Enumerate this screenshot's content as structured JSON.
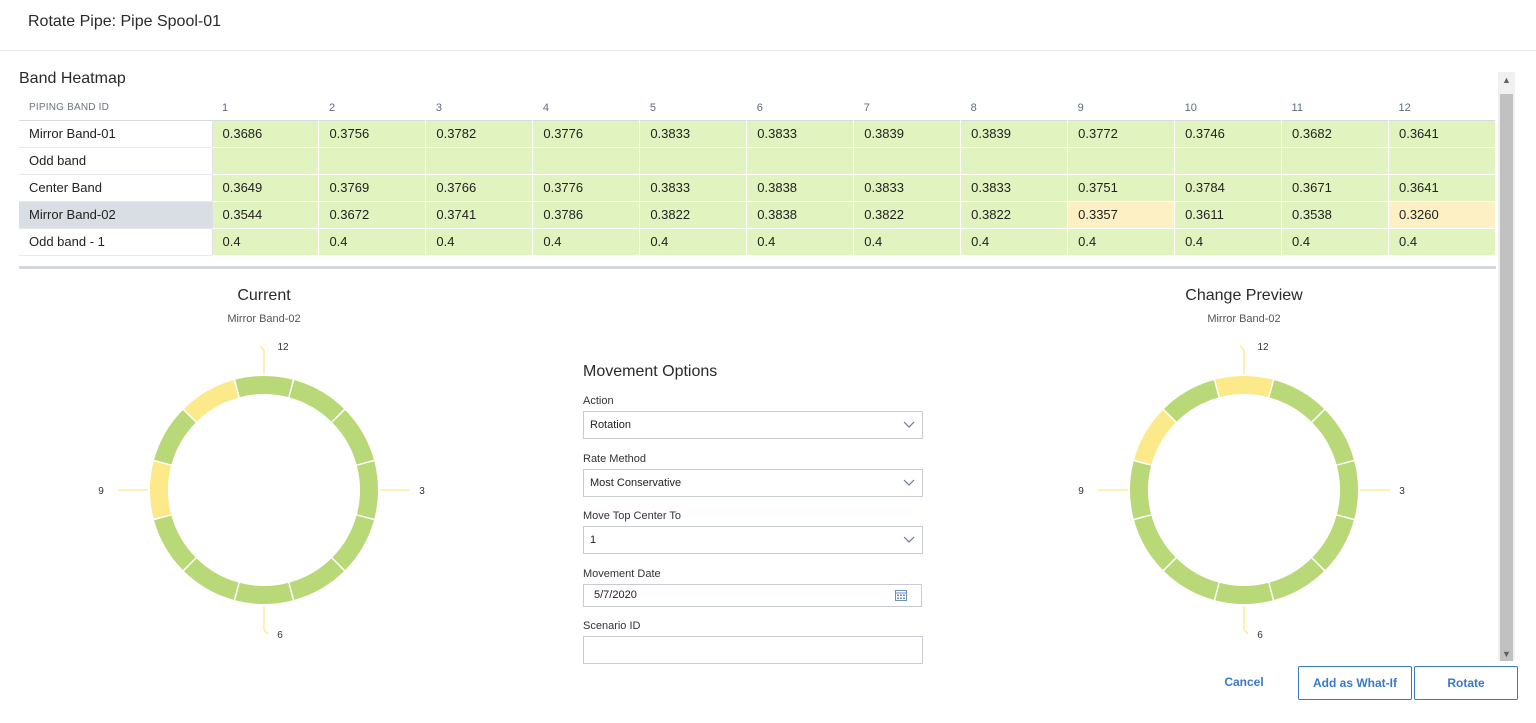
{
  "window": {
    "title": "Rotate Pipe: Pipe Spool-01"
  },
  "heatmap": {
    "title": "Band Heatmap",
    "row_header": "PIPING BAND ID",
    "columns": [
      "1",
      "2",
      "3",
      "4",
      "5",
      "6",
      "7",
      "8",
      "9",
      "10",
      "11",
      "12"
    ],
    "rows": [
      {
        "label": "Mirror Band-01",
        "values": [
          "0.3686",
          "0.3756",
          "0.3782",
          "0.3776",
          "0.3833",
          "0.3833",
          "0.3839",
          "0.3839",
          "0.3772",
          "0.3746",
          "0.3682",
          "0.3641"
        ],
        "warn": []
      },
      {
        "label": "Odd band",
        "values": [
          "",
          "",
          "",
          "",
          "",
          "",
          "",
          "",
          "",
          "",
          "",
          ""
        ],
        "warn": []
      },
      {
        "label": "Center Band",
        "values": [
          "0.3649",
          "0.3769",
          "0.3766",
          "0.3776",
          "0.3833",
          "0.3838",
          "0.3833",
          "0.3833",
          "0.3751",
          "0.3784",
          "0.3671",
          "0.3641"
        ],
        "warn": []
      },
      {
        "label": "Mirror Band-02",
        "values": [
          "0.3544",
          "0.3672",
          "0.3741",
          "0.3786",
          "0.3822",
          "0.3838",
          "0.3822",
          "0.3822",
          "0.3357",
          "0.3611",
          "0.3538",
          "0.3260"
        ],
        "warn": [
          8,
          11
        ],
        "selected": true
      },
      {
        "label": "Odd band - 1",
        "values": [
          "0.4",
          "0.4",
          "0.4",
          "0.4",
          "0.4",
          "0.4",
          "0.4",
          "0.4",
          "0.4",
          "0.4",
          "0.4",
          "0.4"
        ],
        "warn": []
      }
    ],
    "colors": {
      "ok": "#e1f3bf",
      "warn": "#fdf0c4",
      "selected_row": "#d9dee5"
    }
  },
  "current": {
    "title": "Current",
    "subtitle": "Mirror Band-02",
    "labels": {
      "top": "12",
      "right": "3",
      "bottom": "6",
      "left": "9"
    },
    "segments": [
      "green",
      "green",
      "green",
      "green",
      "green",
      "green",
      "green",
      "green",
      "green",
      "yellow",
      "green",
      "yellow"
    ]
  },
  "preview": {
    "title": "Change Preview",
    "subtitle": "Mirror Band-02",
    "labels": {
      "top": "12",
      "right": "3",
      "bottom": "6",
      "left": "9"
    },
    "segments": [
      "yellow",
      "green",
      "green",
      "green",
      "green",
      "green",
      "green",
      "green",
      "green",
      "green",
      "yellow",
      "green"
    ]
  },
  "segment_colors": {
    "green": "#b9d978",
    "yellow": "#fce98a"
  },
  "movement": {
    "title": "Movement Options",
    "action": {
      "label": "Action",
      "value": "Rotation"
    },
    "rate_method": {
      "label": "Rate Method",
      "value": "Most Conservative"
    },
    "move_top": {
      "label": "Move Top Center To",
      "value": "1"
    },
    "movement_date": {
      "label": "Movement Date",
      "value": "5/7/2020"
    },
    "scenario_id": {
      "label": "Scenario ID",
      "value": ""
    }
  },
  "buttons": {
    "cancel": "Cancel",
    "what_if": "Add as What-If",
    "rotate": "Rotate"
  }
}
